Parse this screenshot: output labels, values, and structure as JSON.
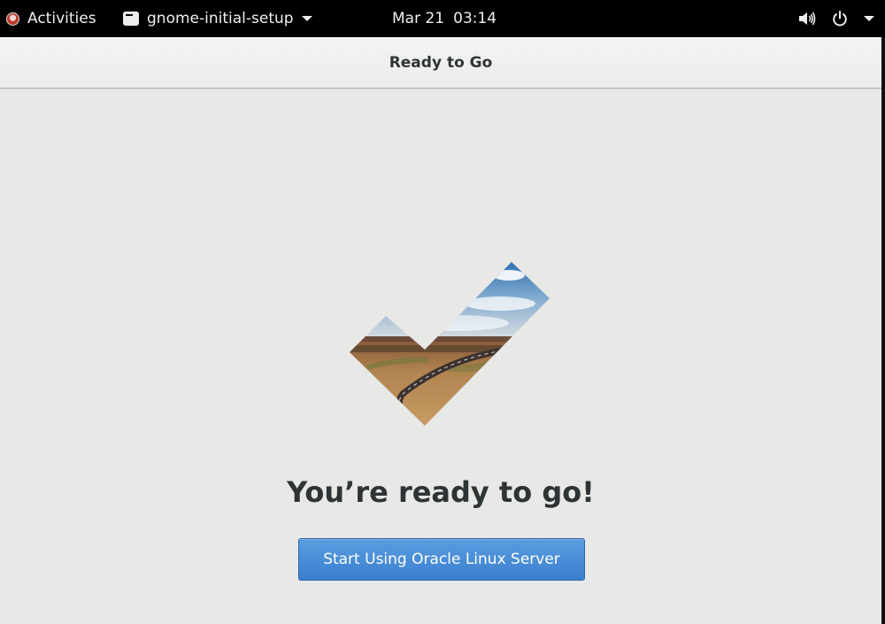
{
  "topbar": {
    "activities_label": "Activities",
    "app_name": "gnome-initial-setup",
    "date": "Mar 21",
    "time": "03:14",
    "icons": [
      "volume-icon",
      "power-icon",
      "chevron-down-icon"
    ]
  },
  "window": {
    "title": "Ready to Go"
  },
  "main": {
    "heading": "You’re ready to go!",
    "start_button_label": "Start Using Oracle Linux Server"
  },
  "colors": {
    "topbar_bg": "#000000",
    "window_bg": "#e8e8e7",
    "button_blue": "#3a7fcf",
    "text_dark": "#2e3436"
  }
}
